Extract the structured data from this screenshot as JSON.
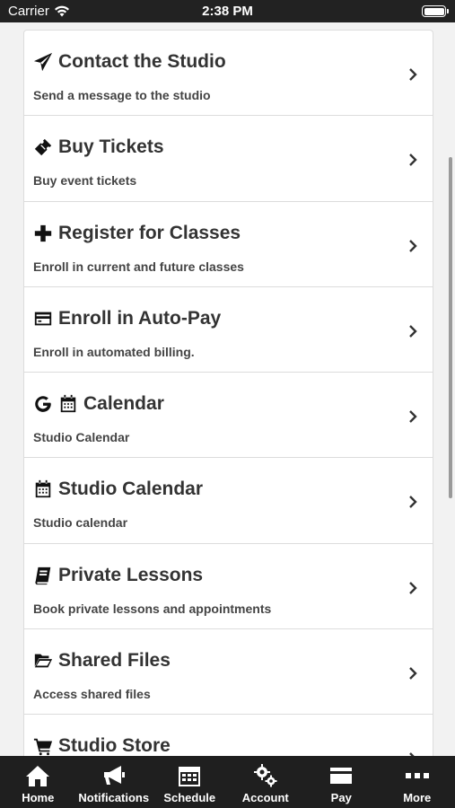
{
  "status_bar": {
    "carrier": "Carrier",
    "time": "2:38 PM",
    "battery_level": 1.0
  },
  "menu": {
    "items": [
      {
        "icon": "paper-plane-icon",
        "title": "Contact the Studio",
        "subtitle": "Send a message to the studio"
      },
      {
        "icon": "ticket-icon",
        "title": "Buy Tickets",
        "subtitle": "Buy event tickets"
      },
      {
        "icon": "plus-icon",
        "title": "Register for Classes",
        "subtitle": "Enroll in current and future classes"
      },
      {
        "icon": "credit-card-icon",
        "title": "Enroll in Auto-Pay",
        "subtitle": "Enroll in automated billing."
      },
      {
        "icon": "google-calendar-icon",
        "title": "Calendar",
        "subtitle": "Studio Calendar"
      },
      {
        "icon": "calendar-icon",
        "title": "Studio Calendar",
        "subtitle": "Studio calendar"
      },
      {
        "icon": "book-icon",
        "title": "Private Lessons",
        "subtitle": "Book private lessons and appointments"
      },
      {
        "icon": "folder-open-icon",
        "title": "Shared Files",
        "subtitle": "Access shared files"
      },
      {
        "icon": "shopping-cart-icon",
        "title": "Studio Store",
        "subtitle": ""
      }
    ]
  },
  "tabbar": {
    "tabs": [
      {
        "icon": "home-icon",
        "label": "Home"
      },
      {
        "icon": "megaphone-icon",
        "label": "Notifications"
      },
      {
        "icon": "calendar-grid-icon",
        "label": "Schedule"
      },
      {
        "icon": "gears-icon",
        "label": "Account"
      },
      {
        "icon": "credit-card-icon",
        "label": "Pay"
      },
      {
        "icon": "ellipsis-icon",
        "label": "More"
      }
    ]
  },
  "colors": {
    "tabbar_background": "#1f1f1f",
    "status_bar_background": "#222222",
    "card_background": "#ffffff",
    "page_background": "#f2f2f2"
  }
}
